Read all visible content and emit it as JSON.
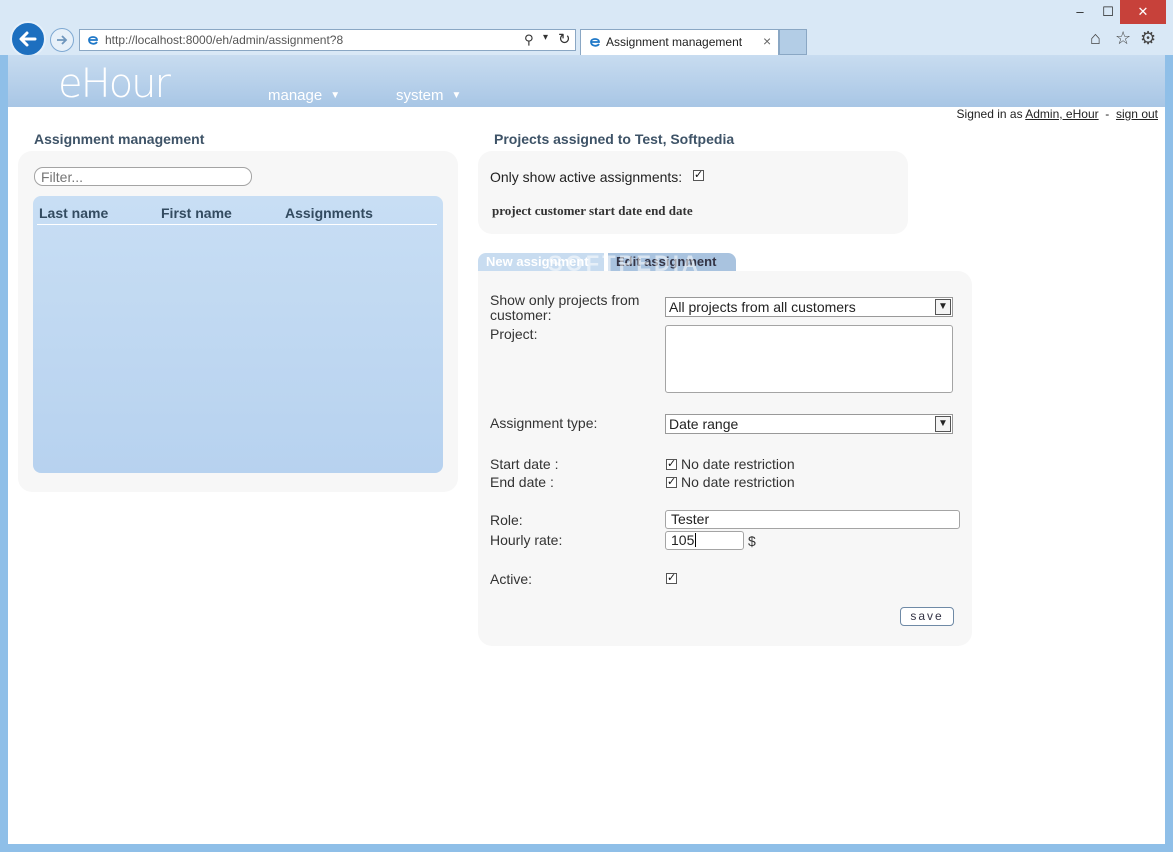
{
  "browser": {
    "address": "http://localhost:8000/eh/admin/assignment?8",
    "tab_title": "Assignment management",
    "tab_close": "×",
    "minimize": "‒",
    "maximize": "☐",
    "close": "✕"
  },
  "app": {
    "logo": "eHour",
    "nav": {
      "manage": "manage",
      "system": "system"
    },
    "signin": {
      "prefix": "Signed in as",
      "user": "Admin, eHour",
      "separator": "-",
      "signout": "sign out"
    }
  },
  "assignment_panel": {
    "title": "Assignment management",
    "filter_placeholder": "Filter...",
    "columns": {
      "last_name": "Last name",
      "first_name": "First name",
      "assignments": "Assignments"
    }
  },
  "projects_panel": {
    "title": "Projects assigned to Test, Softpedia",
    "active_label": "Only show active assignments:",
    "active_checked": true,
    "columns": "project customer start date end date"
  },
  "tabs": {
    "new": "New assignment",
    "edit": "Edit assignment"
  },
  "form": {
    "customer_label": "Show only projects from customer:",
    "customer_value": "All projects from all customers",
    "project_label": "Project:",
    "type_label": "Assignment type:",
    "type_value": "Date range",
    "start_label": "Start date :",
    "end_label": "End date :",
    "no_restriction": "No date restriction",
    "role_label": "Role:",
    "role_value": "Tester",
    "rate_label": "Hourly rate:",
    "rate_value": "105",
    "currency": "$",
    "active_label": "Active:",
    "save": "save"
  },
  "watermark": "SOFTPEDIA",
  "colors": {
    "header": "#b8d1ec",
    "panel": "#f7f7f7",
    "list": "#bfd7f1",
    "window": "#8fbfe8"
  }
}
